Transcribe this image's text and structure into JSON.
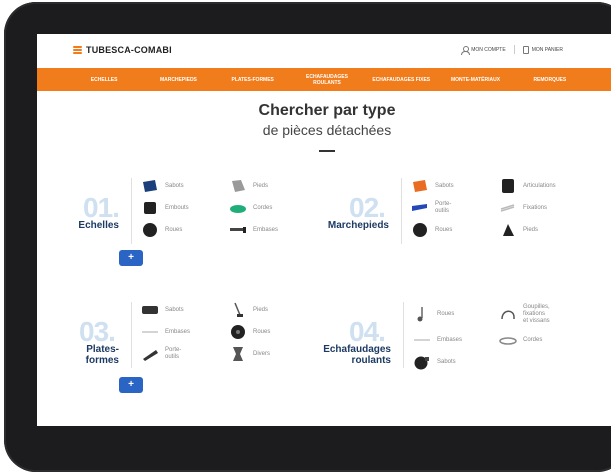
{
  "header": {
    "brand": "TUBESCA-COMABI",
    "account_label": "MON COMPTE",
    "cart_label": "MON PANIER"
  },
  "nav": {
    "items": [
      {
        "label": "ECHELLES"
      },
      {
        "label": "MARCHEPIEDS"
      },
      {
        "label": "PLATES-FORMES"
      },
      {
        "label": "ECHAFAUDAGES ROULANTS"
      },
      {
        "label": "ECHAFAUDAGES FIXES"
      },
      {
        "label": "MONTE-MATÉRIAUX"
      },
      {
        "label": "REMORQUES"
      }
    ]
  },
  "hero": {
    "title": "Chercher par type",
    "subtitle": "de pièces détachées"
  },
  "categories": [
    {
      "number": "01.",
      "name": "Echelles",
      "plus": "+",
      "parts": [
        {
          "label": "Sabots",
          "icon": "sabot-icon"
        },
        {
          "label": "Embouts",
          "icon": "embout-icon"
        },
        {
          "label": "Roues",
          "icon": "roue-icon"
        },
        {
          "label": "Pieds",
          "icon": "pied-icon"
        },
        {
          "label": "Cordes",
          "icon": "corde-icon"
        },
        {
          "label": "Embases",
          "icon": "embase-icon"
        }
      ]
    },
    {
      "number": "02.",
      "name": "Marchepieds",
      "plus": "+",
      "parts": [
        {
          "label": "Sabots",
          "icon": "sabot-icon"
        },
        {
          "label": "Porte-outils",
          "icon": "porte-outils-icon"
        },
        {
          "label": "Roues",
          "icon": "roue-icon"
        },
        {
          "label": "Articulations",
          "icon": "articulation-icon"
        },
        {
          "label": "Fixations",
          "icon": "fixation-icon"
        },
        {
          "label": "Pieds",
          "icon": "pied-icon"
        }
      ]
    },
    {
      "number": "03.",
      "name": "Plates-formes",
      "plus": "+",
      "parts": [
        {
          "label": "Sabots",
          "icon": "sabot-icon"
        },
        {
          "label": "Embases",
          "icon": "embase-icon"
        },
        {
          "label": "Porte-outils",
          "icon": "porte-outils-icon"
        },
        {
          "label": "Pieds",
          "icon": "pied-icon"
        },
        {
          "label": "Roues",
          "icon": "roue-icon"
        },
        {
          "label": "Divers",
          "icon": "divers-icon"
        }
      ]
    },
    {
      "number": "04.",
      "name": "Echafaudages roulants",
      "plus": "+",
      "parts": [
        {
          "label": "Roues",
          "icon": "roue-icon"
        },
        {
          "label": "Embases",
          "icon": "embase-icon"
        },
        {
          "label": "Sabots",
          "icon": "sabot-icon"
        },
        {
          "label": "Goupilles, fixations et vissans",
          "icon": "goupille-icon"
        },
        {
          "label": "Cordes",
          "icon": "corde-icon"
        }
      ]
    }
  ]
}
